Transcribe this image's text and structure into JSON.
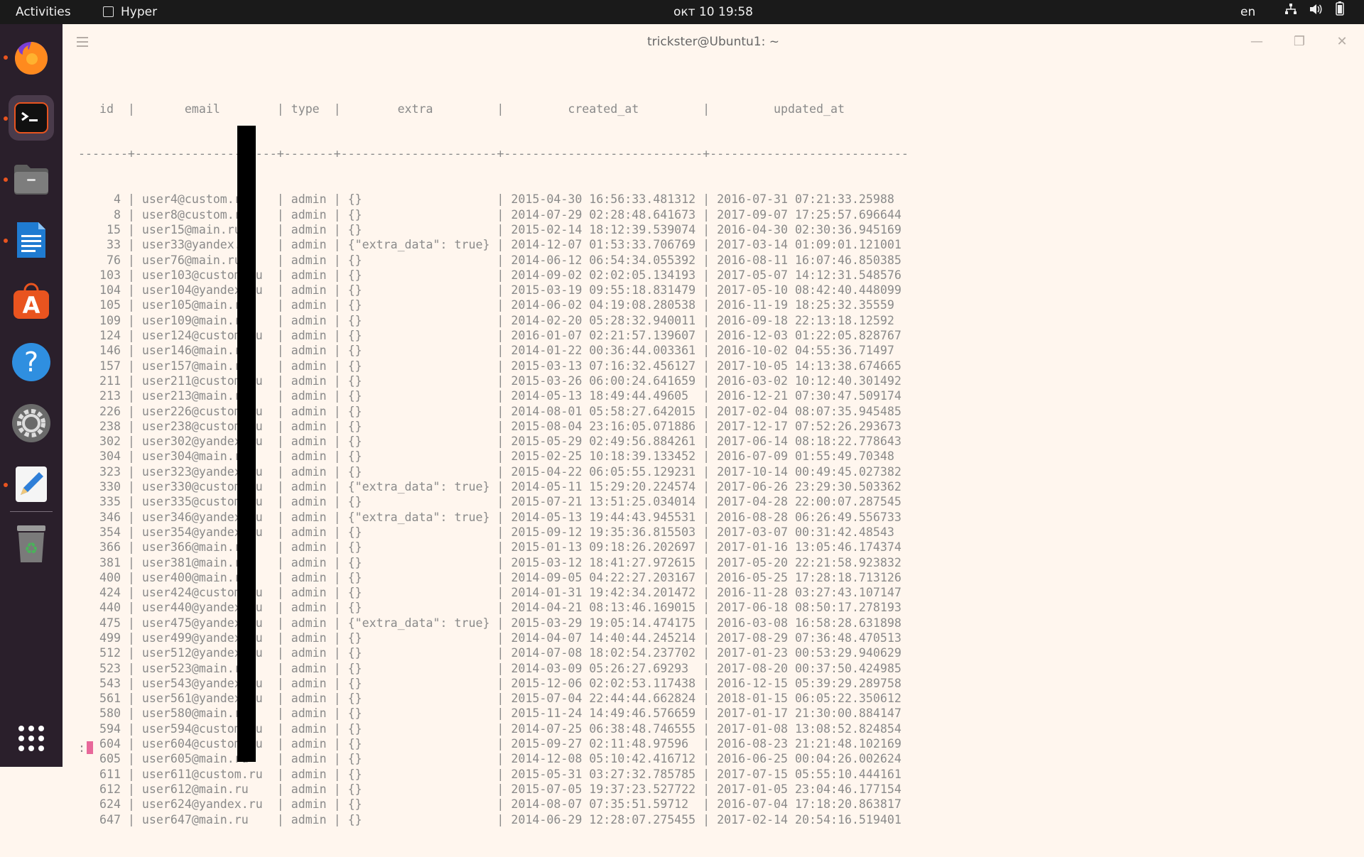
{
  "topbar": {
    "activities": "Activities",
    "app_name": "Hyper",
    "clock": "окт 10  19:58",
    "lang": "en"
  },
  "window": {
    "title": "trickster@Ubuntu1: ~"
  },
  "colors": {
    "accent": "#e9541f",
    "dock_bg": "#2a1f2b",
    "terminal_bg": "#fff6ee",
    "terminal_text": "#8a8a8a"
  },
  "dock": {
    "apps": [
      "firefox-icon",
      "terminal-icon",
      "files-icon",
      "writer-icon",
      "app-center-icon",
      "help-icon",
      "settings-icon",
      "text-editor-icon",
      "trash-icon",
      "show-apps-icon"
    ]
  },
  "terminal": {
    "header": "   id  |       email        | type  |        extra         |         created_at         |         updated_at",
    "separator": "-------+--------------------+-------+----------------------+----------------------------+----------------------------",
    "rows": [
      "     4 | user4@custom.ru    | admin | {}                   | 2015-04-30 16:56:33.481312 | 2016-07-31 07:21:33.25988",
      "     8 | user8@custom.ru    | admin | {}                   | 2014-07-29 02:28:48.641673 | 2017-09-07 17:25:57.696644",
      "    15 | user15@main.ru     | admin | {}                   | 2015-02-14 18:12:39.539074 | 2016-04-30 02:30:36.945169",
      "    33 | user33@yandex.ru   | admin | {\"extra_data\": true} | 2014-12-07 01:53:33.706769 | 2017-03-14 01:09:01.121001",
      "    76 | user76@main.ru     | admin | {}                   | 2014-06-12 06:54:34.055392 | 2016-08-11 16:07:46.850385",
      "   103 | user103@custom.ru  | admin | {}                   | 2014-09-02 02:02:05.134193 | 2017-05-07 14:12:31.548576",
      "   104 | user104@yandex.ru  | admin | {}                   | 2015-03-19 09:55:18.831479 | 2017-05-10 08:42:40.448099",
      "   105 | user105@main.ru    | admin | {}                   | 2014-06-02 04:19:08.280538 | 2016-11-19 18:25:32.35559",
      "   109 | user109@main.ru    | admin | {}                   | 2014-02-20 05:28:32.940011 | 2016-09-18 22:13:18.12592",
      "   124 | user124@custom.ru  | admin | {}                   | 2016-01-07 02:21:57.139607 | 2016-12-03 01:22:05.828767",
      "   146 | user146@main.ru    | admin | {}                   | 2014-01-22 00:36:44.003361 | 2016-10-02 04:55:36.71497",
      "   157 | user157@main.ru    | admin | {}                   | 2015-03-13 07:16:32.456127 | 2017-10-05 14:13:38.674665",
      "   211 | user211@custom.ru  | admin | {}                   | 2015-03-26 06:00:24.641659 | 2016-03-02 10:12:40.301492",
      "   213 | user213@main.ru    | admin | {}                   | 2014-05-13 18:49:44.49605  | 2016-12-21 07:30:47.509174",
      "   226 | user226@custom.ru  | admin | {}                   | 2014-08-01 05:58:27.642015 | 2017-02-04 08:07:35.945485",
      "   238 | user238@custom.ru  | admin | {}                   | 2015-08-04 23:16:05.071886 | 2017-12-17 07:52:26.293673",
      "   302 | user302@yandex.ru  | admin | {}                   | 2015-05-29 02:49:56.884261 | 2017-06-14 08:18:22.778643",
      "   304 | user304@main.ru    | admin | {}                   | 2015-02-25 10:18:39.133452 | 2016-07-09 01:55:49.70348",
      "   323 | user323@yandex.ru  | admin | {}                   | 2015-04-22 06:05:55.129231 | 2017-10-14 00:49:45.027382",
      "   330 | user330@custom.ru  | admin | {\"extra_data\": true} | 2014-05-11 15:29:20.224574 | 2017-06-26 23:29:30.503362",
      "   335 | user335@custom.ru  | admin | {}                   | 2015-07-21 13:51:25.034014 | 2017-04-28 22:00:07.287545",
      "   346 | user346@yandex.ru  | admin | {\"extra_data\": true} | 2014-05-13 19:44:43.945531 | 2016-08-28 06:26:49.556733",
      "   354 | user354@yandex.ru  | admin | {}                   | 2015-09-12 19:35:36.815503 | 2017-03-07 00:31:42.48543",
      "   366 | user366@main.ru    | admin | {}                   | 2015-01-13 09:18:26.202697 | 2017-01-16 13:05:46.174374",
      "   381 | user381@main.ru    | admin | {}                   | 2015-03-12 18:41:27.972615 | 2017-05-20 22:21:58.923832",
      "   400 | user400@main.ru    | admin | {}                   | 2014-09-05 04:22:27.203167 | 2016-05-25 17:28:18.713126",
      "   424 | user424@custom.ru  | admin | {}                   | 2014-01-31 19:42:34.201472 | 2016-11-28 03:27:43.107147",
      "   440 | user440@yandex.ru  | admin | {}                   | 2014-04-21 08:13:46.169015 | 2017-06-18 08:50:17.278193",
      "   475 | user475@yandex.ru  | admin | {\"extra_data\": true} | 2015-03-29 19:05:14.474175 | 2016-03-08 16:58:28.631898",
      "   499 | user499@yandex.ru  | admin | {}                   | 2014-04-07 14:40:44.245214 | 2017-08-29 07:36:48.470513",
      "   512 | user512@yandex.ru  | admin | {}                   | 2014-07-08 18:02:54.237702 | 2017-01-23 00:53:29.940629",
      "   523 | user523@main.ru    | admin | {}                   | 2014-03-09 05:26:27.69293  | 2017-08-20 00:37:50.424985",
      "   543 | user543@yandex.ru  | admin | {}                   | 2015-12-06 02:02:53.117438 | 2016-12-15 05:39:29.289758",
      "   561 | user561@yandex.ru  | admin | {}                   | 2015-07-04 22:44:44.662824 | 2018-01-15 06:05:22.350612",
      "   580 | user580@main.ru    | admin | {}                   | 2015-11-24 14:49:46.576659 | 2017-01-17 21:30:00.884147",
      "   594 | user594@custom.ru  | admin | {}                   | 2014-07-25 06:38:48.746555 | 2017-01-08 13:08:52.824854",
      "   604 | user604@custom.ru  | admin | {}                   | 2015-09-27 02:11:48.97596  | 2016-08-23 21:21:48.102169",
      "   605 | user605@main.ru    | admin | {}                   | 2014-12-08 05:10:42.416712 | 2016-06-25 00:04:26.002624",
      "   611 | user611@custom.ru  | admin | {}                   | 2015-05-31 03:27:32.785785 | 2017-07-15 05:55:10.444161",
      "   612 | user612@main.ru    | admin | {}                   | 2015-07-05 19:37:23.527722 | 2017-01-05 23:04:46.177154",
      "   624 | user624@yandex.ru  | admin | {}                   | 2014-08-07 07:35:51.59712  | 2016-07-04 17:18:20.863817",
      "   647 | user647@main.ru    | admin | {}                   | 2014-06-29 12:28:07.275455 | 2017-02-14 20:54:16.519401"
    ],
    "prompt": ":"
  }
}
